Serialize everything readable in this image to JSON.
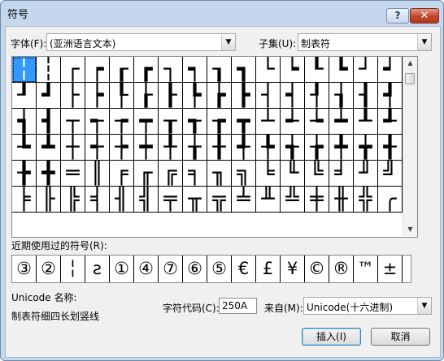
{
  "dialog": {
    "title": "符号",
    "help_glyph": "?",
    "close_glyph": "✕"
  },
  "font": {
    "label": "字体(F):",
    "value": "(亚洲语言文本)"
  },
  "subset": {
    "label": "子集(U):",
    "value": "制表符"
  },
  "symbols_grid": {
    "selected_index": 0,
    "rows": [
      [
        "╎",
        "┆",
        "┌",
        "┍",
        "┎",
        "┏",
        "┐",
        "┑",
        "┒",
        "┓",
        "└",
        "┕",
        "┖",
        "┗",
        "┘",
        "┙"
      ],
      [
        "┚",
        "┛",
        "├",
        "┝",
        "┞",
        "┟",
        "┠",
        "┡",
        "┢",
        "┣",
        "┤",
        "┥",
        "┦",
        "┧",
        "┨",
        "┩"
      ],
      [
        "┪",
        "┫",
        "┬",
        "┭",
        "┮",
        "┯",
        "┰",
        "┱",
        "┲",
        "┳",
        "┴",
        "┵",
        "┶",
        "┷",
        "┸",
        "┹"
      ],
      [
        "┺",
        "┻",
        "┼",
        "┽",
        "┾",
        "┿",
        "╀",
        "╁",
        "╂",
        "╃",
        "╄",
        "╅",
        "╆",
        "╇",
        "╈",
        "╉"
      ],
      [
        "╊",
        "╋",
        "═",
        "║",
        "╒",
        "╓",
        "╔",
        "╕",
        "╖",
        "╗",
        "╘",
        "╙",
        "╚",
        "╛",
        "╜",
        "╝"
      ],
      [
        "╞",
        "╟",
        "╠",
        "╡",
        "╢",
        "╣",
        "╤",
        "╥",
        "╦",
        "╧",
        "╨",
        "╩",
        "╪",
        "╫",
        "╬",
        "╭"
      ]
    ]
  },
  "scrollbar": {
    "up_glyph": "▲",
    "down_glyph": "▼"
  },
  "recent": {
    "label": "近期使用过的符号(R):",
    "symbols": [
      "③",
      "②",
      "╎",
      "ƨ",
      "①",
      "④",
      "⑦",
      "⑥",
      "⑤",
      "€",
      "£",
      "¥",
      "©",
      "®",
      "™",
      "±"
    ]
  },
  "unicode_name": {
    "label": "Unicode 名称:",
    "value": "制表符细四长划竖线"
  },
  "char_code": {
    "label": "字符代码(C):",
    "value": "250A"
  },
  "from": {
    "label": "来自(M):",
    "value": "Unicode(十六进制)"
  },
  "buttons": {
    "insert": "插入(I)",
    "cancel": "取消"
  }
}
